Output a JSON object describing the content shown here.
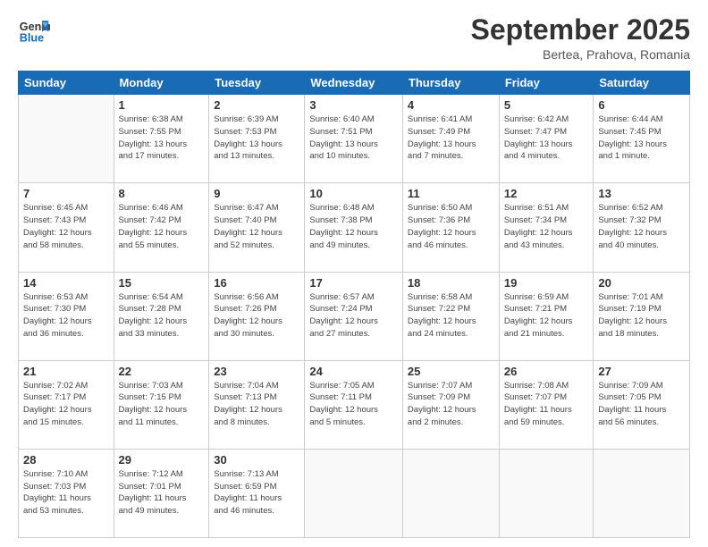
{
  "logo": {
    "line1": "General",
    "line2": "Blue"
  },
  "title": "September 2025",
  "location": "Bertea, Prahova, Romania",
  "days_header": [
    "Sunday",
    "Monday",
    "Tuesday",
    "Wednesday",
    "Thursday",
    "Friday",
    "Saturday"
  ],
  "weeks": [
    [
      {
        "num": "",
        "info": ""
      },
      {
        "num": "1",
        "info": "Sunrise: 6:38 AM\nSunset: 7:55 PM\nDaylight: 13 hours\nand 17 minutes."
      },
      {
        "num": "2",
        "info": "Sunrise: 6:39 AM\nSunset: 7:53 PM\nDaylight: 13 hours\nand 13 minutes."
      },
      {
        "num": "3",
        "info": "Sunrise: 6:40 AM\nSunset: 7:51 PM\nDaylight: 13 hours\nand 10 minutes."
      },
      {
        "num": "4",
        "info": "Sunrise: 6:41 AM\nSunset: 7:49 PM\nDaylight: 13 hours\nand 7 minutes."
      },
      {
        "num": "5",
        "info": "Sunrise: 6:42 AM\nSunset: 7:47 PM\nDaylight: 13 hours\nand 4 minutes."
      },
      {
        "num": "6",
        "info": "Sunrise: 6:44 AM\nSunset: 7:45 PM\nDaylight: 13 hours\nand 1 minute."
      }
    ],
    [
      {
        "num": "7",
        "info": "Sunrise: 6:45 AM\nSunset: 7:43 PM\nDaylight: 12 hours\nand 58 minutes."
      },
      {
        "num": "8",
        "info": "Sunrise: 6:46 AM\nSunset: 7:42 PM\nDaylight: 12 hours\nand 55 minutes."
      },
      {
        "num": "9",
        "info": "Sunrise: 6:47 AM\nSunset: 7:40 PM\nDaylight: 12 hours\nand 52 minutes."
      },
      {
        "num": "10",
        "info": "Sunrise: 6:48 AM\nSunset: 7:38 PM\nDaylight: 12 hours\nand 49 minutes."
      },
      {
        "num": "11",
        "info": "Sunrise: 6:50 AM\nSunset: 7:36 PM\nDaylight: 12 hours\nand 46 minutes."
      },
      {
        "num": "12",
        "info": "Sunrise: 6:51 AM\nSunset: 7:34 PM\nDaylight: 12 hours\nand 43 minutes."
      },
      {
        "num": "13",
        "info": "Sunrise: 6:52 AM\nSunset: 7:32 PM\nDaylight: 12 hours\nand 40 minutes."
      }
    ],
    [
      {
        "num": "14",
        "info": "Sunrise: 6:53 AM\nSunset: 7:30 PM\nDaylight: 12 hours\nand 36 minutes."
      },
      {
        "num": "15",
        "info": "Sunrise: 6:54 AM\nSunset: 7:28 PM\nDaylight: 12 hours\nand 33 minutes."
      },
      {
        "num": "16",
        "info": "Sunrise: 6:56 AM\nSunset: 7:26 PM\nDaylight: 12 hours\nand 30 minutes."
      },
      {
        "num": "17",
        "info": "Sunrise: 6:57 AM\nSunset: 7:24 PM\nDaylight: 12 hours\nand 27 minutes."
      },
      {
        "num": "18",
        "info": "Sunrise: 6:58 AM\nSunset: 7:22 PM\nDaylight: 12 hours\nand 24 minutes."
      },
      {
        "num": "19",
        "info": "Sunrise: 6:59 AM\nSunset: 7:21 PM\nDaylight: 12 hours\nand 21 minutes."
      },
      {
        "num": "20",
        "info": "Sunrise: 7:01 AM\nSunset: 7:19 PM\nDaylight: 12 hours\nand 18 minutes."
      }
    ],
    [
      {
        "num": "21",
        "info": "Sunrise: 7:02 AM\nSunset: 7:17 PM\nDaylight: 12 hours\nand 15 minutes."
      },
      {
        "num": "22",
        "info": "Sunrise: 7:03 AM\nSunset: 7:15 PM\nDaylight: 12 hours\nand 11 minutes."
      },
      {
        "num": "23",
        "info": "Sunrise: 7:04 AM\nSunset: 7:13 PM\nDaylight: 12 hours\nand 8 minutes."
      },
      {
        "num": "24",
        "info": "Sunrise: 7:05 AM\nSunset: 7:11 PM\nDaylight: 12 hours\nand 5 minutes."
      },
      {
        "num": "25",
        "info": "Sunrise: 7:07 AM\nSunset: 7:09 PM\nDaylight: 12 hours\nand 2 minutes."
      },
      {
        "num": "26",
        "info": "Sunrise: 7:08 AM\nSunset: 7:07 PM\nDaylight: 11 hours\nand 59 minutes."
      },
      {
        "num": "27",
        "info": "Sunrise: 7:09 AM\nSunset: 7:05 PM\nDaylight: 11 hours\nand 56 minutes."
      }
    ],
    [
      {
        "num": "28",
        "info": "Sunrise: 7:10 AM\nSunset: 7:03 PM\nDaylight: 11 hours\nand 53 minutes."
      },
      {
        "num": "29",
        "info": "Sunrise: 7:12 AM\nSunset: 7:01 PM\nDaylight: 11 hours\nand 49 minutes."
      },
      {
        "num": "30",
        "info": "Sunrise: 7:13 AM\nSunset: 6:59 PM\nDaylight: 11 hours\nand 46 minutes."
      },
      {
        "num": "",
        "info": ""
      },
      {
        "num": "",
        "info": ""
      },
      {
        "num": "",
        "info": ""
      },
      {
        "num": "",
        "info": ""
      }
    ]
  ]
}
